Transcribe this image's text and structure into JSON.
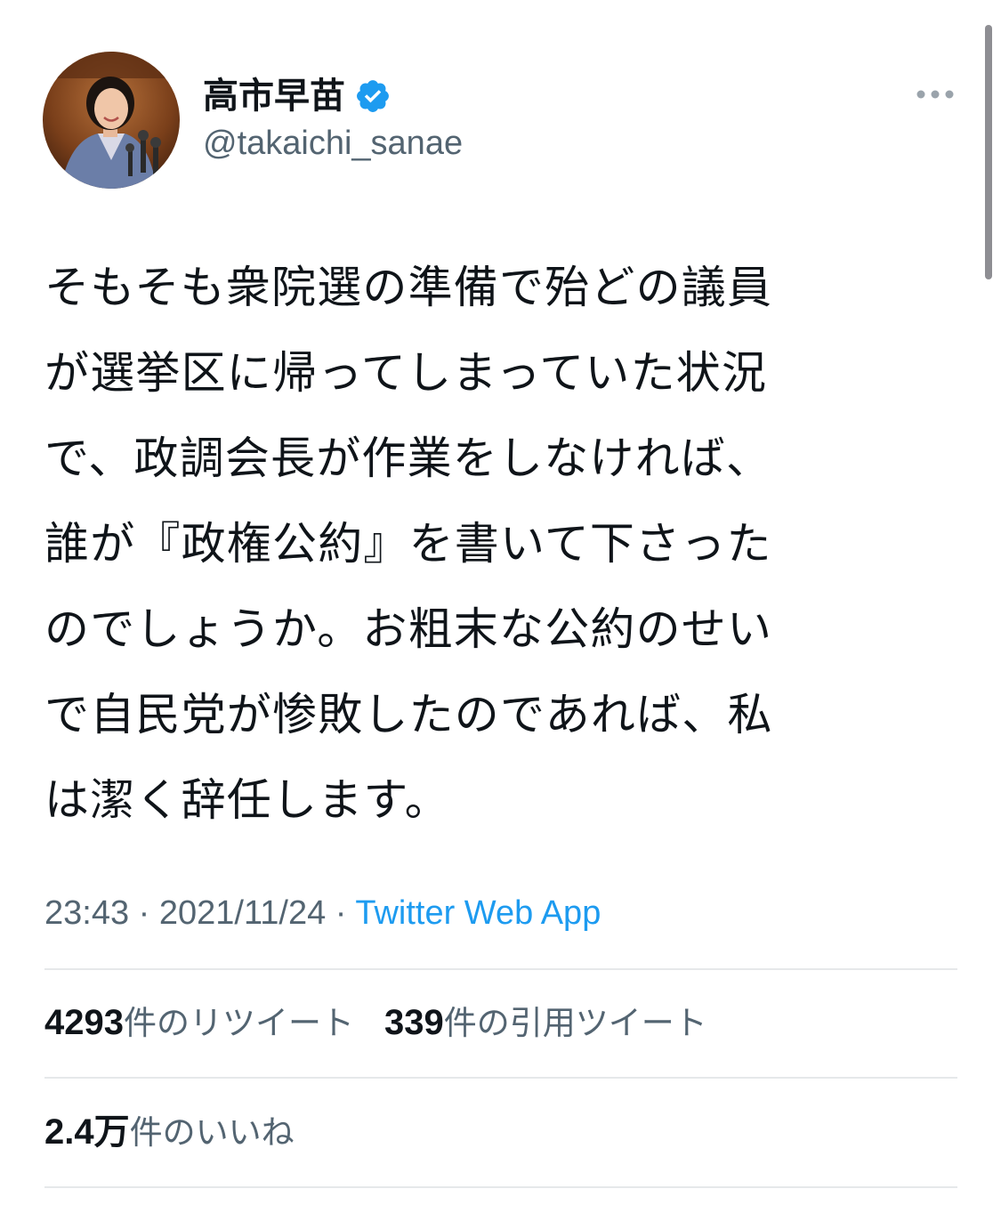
{
  "author": {
    "display_name": "高市早苗",
    "handle": "@takaichi_sanae",
    "verified": true
  },
  "tweet": {
    "text": "そもそも衆院選の準備で殆どの議員\nが選挙区に帰ってしまっていた状況\nで、政調会長が作業をしなければ、\n誰が『政権公約』を書いて下さった\nのでしょうか。お粗末な公約のせい\nで自民党が惨敗したのであれば、私\nは潔く辞任します。",
    "time": "23:43",
    "date": "2021/11/24",
    "separator": " · ",
    "source": "Twitter Web App"
  },
  "stats": {
    "retweets_count": "4293",
    "retweets_label": "件のリツイート",
    "quotes_count": "339",
    "quotes_label": "件の引用ツイート",
    "likes_count": "2.4万",
    "likes_label": "件のいいね"
  },
  "colors": {
    "primary_text": "#0f1419",
    "secondary_text": "#536471",
    "accent": "#1d9bf0",
    "divider": "#e6e8ea"
  },
  "icons": {
    "verified": "verified-badge-icon",
    "more": "more-options-icon"
  }
}
